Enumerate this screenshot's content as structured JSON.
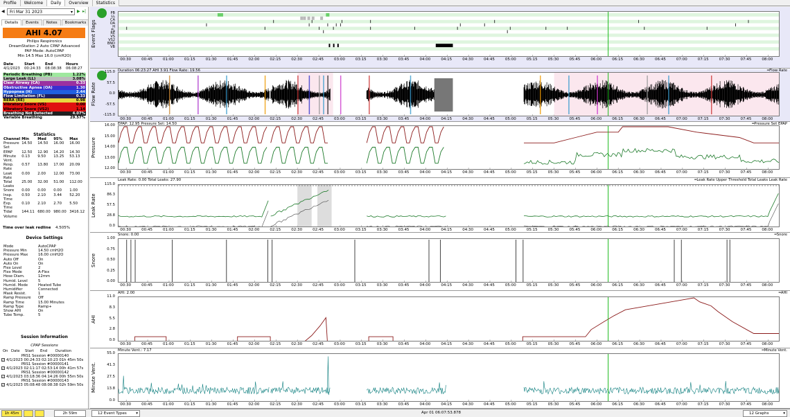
{
  "top_tabs": [
    "Profile",
    "Welcome",
    "Daily",
    "Overview",
    "Statistics"
  ],
  "nav": {
    "prev": "◀",
    "date": "Fri Mar 31 2023",
    "next": "▶",
    "last": "▸|"
  },
  "sub_tabs": [
    "Details",
    "Events",
    "Notes",
    "Bookmarks"
  ],
  "ahi_banner": "AHI 4.07",
  "machine": [
    "Philips Respironics",
    "DreamStation 2 Auto CPAP Advanced",
    "PAP Mode: AutoCPAP",
    "Min 14.5 Max 16.0 (cmH2O)"
  ],
  "session_head": [
    "Date",
    "Start",
    "End",
    "Hours"
  ],
  "session_row": [
    "4/1/2023",
    "00:24:33",
    "08:08:38",
    "06:08:27"
  ],
  "events": [
    {
      "label": "Periodic Breathing (PB)",
      "value": "1.22%",
      "color": "#9fe89f"
    },
    {
      "label": "Large Leak (LL)",
      "value": "3.08%",
      "color": "#bcbcbc"
    },
    {
      "label": "Clear Airway (CA)",
      "value": "0.33",
      "color": "#9b30a0"
    },
    {
      "label": "Obstructive Apnea (OA)",
      "value": "1.30",
      "color": "#3a2fd0"
    },
    {
      "label": "Hypopnea (H)",
      "value": "2.44",
      "color": "#2060e0"
    },
    {
      "label": "Flow Limitation (FL)",
      "value": "0.33",
      "color": "#202060"
    },
    {
      "label": "RERA (RE)",
      "value": "0.98",
      "color": "#e8d840"
    },
    {
      "label": "Vibratory Snore (VS)",
      "value": "0.00",
      "color": "#e01010"
    },
    {
      "label": "Vibratory Snore (VS2)",
      "value": "1.14",
      "color": "#e01010"
    },
    {
      "label": "Breathing Not Detected",
      "value": "4.07%",
      "color": "#202020"
    },
    {
      "label": "Variable Breathing",
      "value": "29.57%",
      "color": "#ffffff"
    }
  ],
  "stats_title": "Statistics",
  "stats_head": [
    "Channel",
    "Min",
    "Med",
    "95%",
    "Max"
  ],
  "stats_rows": [
    [
      "Pressure Set",
      "14.50",
      "14.50",
      "16.00",
      "16.00"
    ],
    [
      "EPAP",
      "12.50",
      "12.90",
      "14.20",
      "14.30"
    ],
    [
      "Minute Vent.",
      "0.13",
      "9.50",
      "13.25",
      "53.13"
    ],
    [
      "Resp. Rate",
      "0.57",
      "13.80",
      "17.00",
      "20.09"
    ],
    [
      "Leak Rate",
      "0.00",
      "2.00",
      "12.00",
      "73.00"
    ],
    [
      "Total Leaks",
      "25.00",
      "32.00",
      "51.00",
      "112.00"
    ],
    [
      "Snore",
      "0.00",
      "0.00",
      "0.00",
      "1.00"
    ],
    [
      "Insp. Time",
      "0.50",
      "2.10",
      "3.44",
      "52.20"
    ],
    [
      "Exp. Time",
      "0.10",
      "2.10",
      "2.70",
      "5.50"
    ],
    [
      "Tidal Volume",
      "144.11",
      "680.00",
      "980.00",
      "3416.12"
    ]
  ],
  "leak_redline": {
    "label": "Time over leak redline",
    "value": "4.505%"
  },
  "device_title": "Device Settings",
  "device_rows": [
    [
      "Mode",
      "AutoCPAP"
    ],
    [
      "Pressure Min",
      "14.50 cmH2O"
    ],
    [
      "Pressure Max",
      "16.00 cmH2O"
    ],
    [
      "Auto Off",
      "On"
    ],
    [
      "Auto On",
      "On"
    ],
    [
      "Flex Level",
      "2"
    ],
    [
      "Flex Mode",
      "A-Flex"
    ],
    [
      "Hose Diam.",
      "12mm"
    ],
    [
      "Humid. Level",
      "5"
    ],
    [
      "Humid. Mode",
      "Heated Tube"
    ],
    [
      "Humidifier",
      "Connected"
    ],
    [
      "Mask Resist.",
      "1"
    ],
    [
      "Ramp Pressure",
      "Off"
    ],
    [
      "Ramp Time",
      "15.00 Minutes"
    ],
    [
      "Ramp Type",
      "Ramp+"
    ],
    [
      "Show AHI",
      "On"
    ],
    [
      "Tube Temp.",
      "5"
    ]
  ],
  "session_info_title": "Session Information",
  "cpap_sessions": "CPAP Sessions",
  "sessions_head": [
    "On",
    "Date",
    "Start",
    "End",
    "Duration"
  ],
  "sessions": [
    {
      "name": "PRS1 Session #00000140",
      "row": "4/1/2023 00:24:33 02:10:23 01h 45m 50s"
    },
    {
      "name": "PRS1 Session #00000141",
      "row": "4/1/2023 02:11:17 02:53:14 00h 41m 57s"
    },
    {
      "name": "PRS1 Session #00000142",
      "row": "4/1/2023 03:18:36 04:14:26 00h 55m 50s"
    },
    {
      "name": "PRS1 Session #00000143",
      "row": "4/1/2023 05:08:48 08:08:38 02h 59m 50s"
    }
  ],
  "x_ticks": [
    "00:30",
    "00:45",
    "01:00",
    "01:15",
    "01:30",
    "01:45",
    "02:00",
    "02:15",
    "02:30",
    "02:45",
    "03:00",
    "03:15",
    "03:30",
    "03:45",
    "04:00",
    "04:15",
    "04:30",
    "04:45",
    "05:00",
    "05:15",
    "05:30",
    "05:45",
    "06:00",
    "06:15",
    "06:30",
    "06:45",
    "07:00",
    "07:15",
    "07:30",
    "07:45",
    "08:00"
  ],
  "panels": {
    "flags": {
      "label": "Event Flags",
      "rows": [
        "PB",
        "LL",
        "CA",
        "OA",
        "H",
        "FL",
        "RE",
        "VS",
        "VS2",
        "BND",
        "VB"
      ]
    },
    "flow": {
      "label": "Flow Rate",
      "title": "Duration 06:23:27 AHI 3.91 Flow Rate: 19.56",
      "legend": "Flow Rate",
      "yticks": [
        "115.0",
        "57.5",
        "0.0",
        "-57.5",
        "-115.0"
      ]
    },
    "pressure": {
      "label": "Pressure",
      "title": "EPAP: 12.95 Pressure Set: 14.50",
      "legend": "Pressure Set  EPAP",
      "yticks": [
        "16.00",
        "15.00",
        "14.00",
        "13.00",
        "12.00"
      ]
    },
    "leak": {
      "label": "Leak Rate",
      "title": "Leak Rate: 0.00 Total Leaks: 27.90",
      "legend": "Leak Rate Upper Threshold  Total Leaks  Leak Rate",
      "yticks": [
        "115.0",
        "86.3",
        "57.5",
        "28.8",
        "0.0"
      ]
    },
    "snore": {
      "label": "Snore",
      "title": "Snore: 0.00",
      "legend": "Snore",
      "yticks": [
        "1.00",
        "0.75",
        "0.50",
        "0.25",
        "0.00"
      ]
    },
    "ahi": {
      "label": "AHI",
      "title": "AHI: 2.00",
      "legend": "AHI",
      "yticks": [
        "11.0",
        "8.3",
        "5.5",
        "2.8",
        "0.0"
      ]
    },
    "minvent": {
      "label": "Minute Vent.",
      "title": "Minute Vent.: 7.17",
      "legend": "Minute Vent.",
      "yticks": [
        "55.0",
        "41.3",
        "27.5",
        "13.8",
        "0.0"
      ]
    }
  },
  "status": {
    "left_time": "1h 45m",
    "right_time": "2h 59m",
    "event_types": "12 Event Types",
    "cursor_time": "Apr 01 06:07:53.878",
    "graphs": "12 Graphs"
  },
  "colors": {
    "ahi_banner": "#f57c14",
    "pressure_set": "#8b1a1a",
    "epap": "#1d7a2a",
    "leak": "#1d7a2a",
    "ahi_line": "#8b1a1a",
    "minvent": "#0f7f7f",
    "cursor": "#1cba1c"
  }
}
